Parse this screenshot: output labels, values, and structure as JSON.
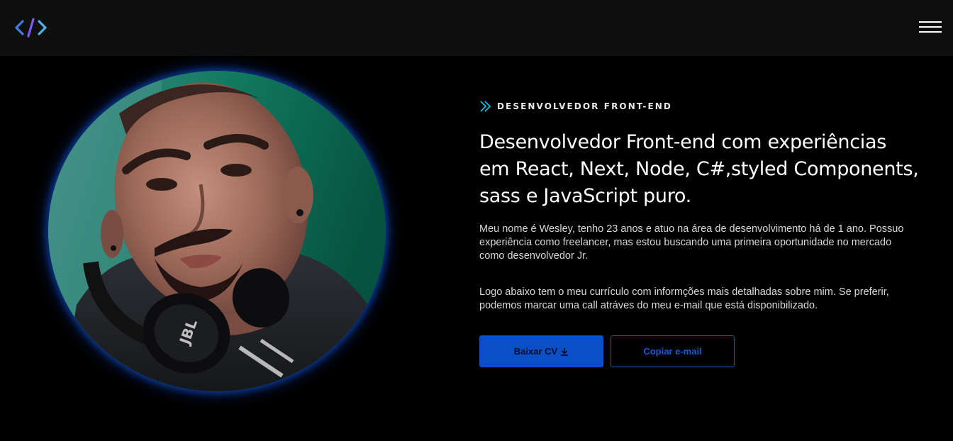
{
  "header": {
    "logo_icon": "code-brackets-icon",
    "menu_icon": "hamburger-menu-icon"
  },
  "hero": {
    "eyebrow": "DESENVOLVEDOR FRONT-END",
    "eyebrow_icon": "double-chevron-right-icon",
    "headline": "Desenvolvedor Front-end com experiências em React, Next, Node, C#,styled Components, sass e JavaScript puro.",
    "paragraph_1": "Meu nome é Wesley, tenho 23 anos e atuo na área de desenvolvimento há de 1 ano. Possuo experiência como freelancer, mas estou buscando uma primeira oportunidade no mercado como desenvolvedor Jr.",
    "paragraph_2": "Logo abaixo tem o meu currículo com informções mais detalhadas sobre mim. Se preferir, podemos marcar uma call atráves do meu e-mail que está disponibilizado.",
    "download_button": "Baixar CV",
    "download_icon": "download-icon",
    "copy_email_button": "Copiar e-mail",
    "photo_headphone_brand": "JBL"
  },
  "colors": {
    "background": "#000000",
    "header_background": "#0f0f10",
    "accent_blue": "#0b4fc6",
    "accent_cyan": "#1fb6d6",
    "avatar_glow": "#0d3b9e"
  }
}
